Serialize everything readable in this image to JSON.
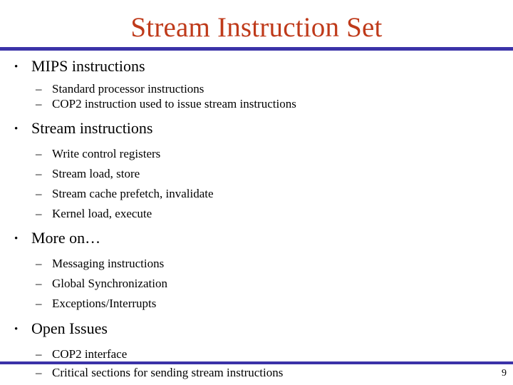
{
  "slide": {
    "title": "Stream Instruction Set",
    "title_color": "#bf3a1a",
    "rule_color": "#3b33a8",
    "background_color": "#ffffff",
    "page_number": "9",
    "bullet_marker": "•",
    "sub_bullet_marker": "–",
    "groups": [
      {
        "heading": "MIPS instructions",
        "items": [
          "Standard processor instructions",
          "COP2 instruction used to issue stream instructions"
        ]
      },
      {
        "heading": "Stream instructions",
        "items": [
          "Write control registers",
          "Stream load, store",
          "Stream cache prefetch, invalidate",
          "Kernel load, execute"
        ]
      },
      {
        "heading": "More on…",
        "items": [
          "Messaging instructions",
          "Global Synchronization",
          "Exceptions/Interrupts"
        ]
      },
      {
        "heading": "Open Issues",
        "items": [
          "COP2 interface",
          "Critical sections for sending stream instructions"
        ]
      }
    ]
  }
}
